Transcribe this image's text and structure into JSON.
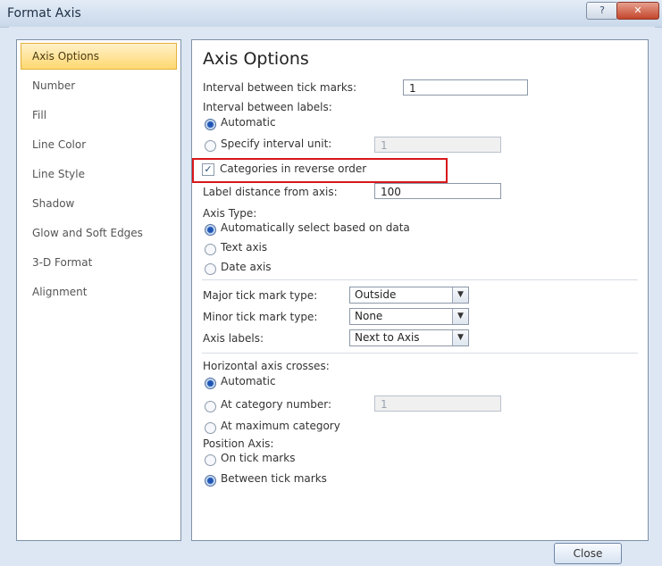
{
  "window": {
    "title": "Format Axis",
    "help_label": "?",
    "close_label": "✕"
  },
  "sidebar": {
    "items": [
      {
        "label": "Axis Options",
        "selected": true
      },
      {
        "label": "Number"
      },
      {
        "label": "Fill"
      },
      {
        "label": "Line Color"
      },
      {
        "label": "Line Style"
      },
      {
        "label": "Shadow"
      },
      {
        "label": "Glow and Soft Edges"
      },
      {
        "label": "3-D Format"
      },
      {
        "label": "Alignment"
      }
    ]
  },
  "panel": {
    "heading": "Axis Options",
    "interval_ticks": {
      "label": "Interval between tick marks:",
      "value": "1"
    },
    "interval_labels": {
      "label": "Interval between labels:",
      "automatic": "Automatic",
      "specify": "Specify interval unit:",
      "specify_value": "1"
    },
    "reverse_order": {
      "label": "Categories in reverse order",
      "checked": true
    },
    "label_distance": {
      "label": "Label distance from axis:",
      "value": "100"
    },
    "axis_type": {
      "label": "Axis Type:",
      "auto": "Automatically select based on data",
      "text": "Text axis",
      "date": "Date axis"
    },
    "major_tick": {
      "label": "Major tick mark type:",
      "value": "Outside"
    },
    "minor_tick": {
      "label": "Minor tick mark type:",
      "value": "None"
    },
    "axis_labels": {
      "label": "Axis labels:",
      "value": "Next to Axis"
    },
    "horizontal_crosses": {
      "label": "Horizontal axis crosses:",
      "automatic": "Automatic",
      "at_category": "At category number:",
      "at_category_value": "1",
      "at_max": "At maximum category"
    },
    "position_axis": {
      "label": "Position Axis:",
      "on_tick": "On tick marks",
      "between": "Between tick marks"
    }
  },
  "footer": {
    "close_button": "Close"
  },
  "colors": {
    "accent": "#1f56b5",
    "selected_bg": "#ffd870",
    "highlight_border": "#d8181b"
  }
}
